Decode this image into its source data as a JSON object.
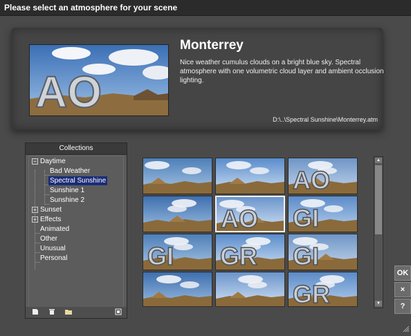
{
  "window": {
    "title": "Please select an atmosphere for your scene"
  },
  "preview": {
    "name": "Monterrey",
    "description": "Nice weather cumulus clouds on a bright blue sky. Spectral atmosphere with one volumetric cloud layer and ambient occlusion lighting.",
    "path": "D:\\..\\Spectral Sunshine\\Monterrey.atm",
    "thumb_text": "AO"
  },
  "collections": {
    "header": "Collections",
    "tree": [
      {
        "label": "Daytime",
        "expander": "−"
      },
      {
        "label": "Bad Weather"
      },
      {
        "label": "Spectral Sunshine",
        "selected": true
      },
      {
        "label": "Sunshine 1"
      },
      {
        "label": "Sunshine 2"
      },
      {
        "label": "Sunset",
        "expander": "+"
      },
      {
        "label": "Effects",
        "expander": "+"
      },
      {
        "label": "Animated"
      },
      {
        "label": "Other"
      },
      {
        "label": "Unusual"
      },
      {
        "label": "Personal"
      }
    ],
    "toolbar_icons": [
      "new-collection-icon",
      "delete-icon",
      "open-folder-icon",
      "properties-icon"
    ]
  },
  "thumbnails": [
    {
      "text": ""
    },
    {
      "text": ""
    },
    {
      "text": "AO"
    },
    {
      "text": ""
    },
    {
      "text": "AO",
      "selected": true
    },
    {
      "text": "GI"
    },
    {
      "text": "GI"
    },
    {
      "text": "GR"
    },
    {
      "text": "GI"
    },
    {
      "text": ""
    },
    {
      "text": ""
    },
    {
      "text": "GR"
    }
  ],
  "buttons": {
    "ok": "OK",
    "cancel": "×",
    "help": "?"
  },
  "colors": {
    "sky": "#4a7fc0",
    "cloud": "#f2f4f8",
    "ground": "#8a6a3a",
    "selection": "#1a2c78"
  }
}
